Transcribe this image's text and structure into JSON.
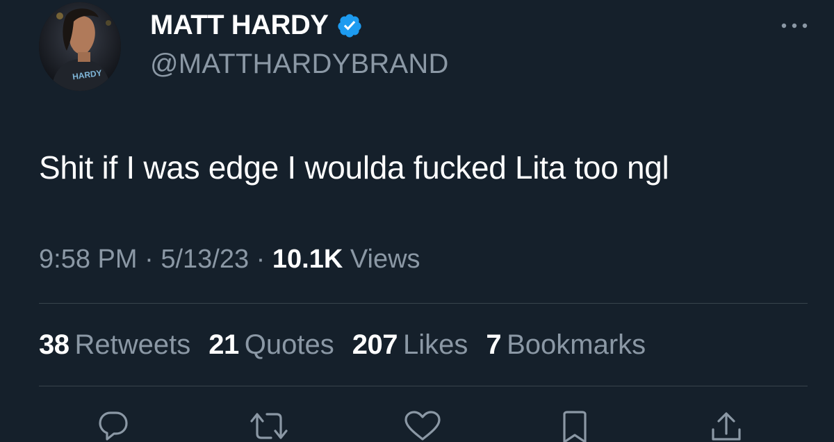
{
  "author": {
    "display_name": "MATT HARDY",
    "handle": "@MATTHARDYBRAND",
    "avatar_shirt_text": "HARDY",
    "verified_icon": "verified-badge-icon"
  },
  "tweet": {
    "text": "Shit if I was edge I woulda fucked Lita too ngl"
  },
  "meta": {
    "time": "9:58 PM",
    "separator1": " · ",
    "date": "5/13/23",
    "separator2": " · ",
    "views_count": "10.1K",
    "views_label": " Views"
  },
  "stats": {
    "retweets_count": "38",
    "retweets_label": "Retweets",
    "quotes_count": "21",
    "quotes_label": "Quotes",
    "likes_count": "207",
    "likes_label": "Likes",
    "bookmarks_count": "7",
    "bookmarks_label": "Bookmarks"
  },
  "actions": {
    "reply": "reply-icon",
    "retweet": "retweet-icon",
    "like": "heart-icon",
    "bookmark": "bookmark-icon",
    "share": "share-icon"
  },
  "colors": {
    "background": "#15202b",
    "text_primary": "#ffffff",
    "text_secondary": "#8b98a5",
    "divider": "#38444d",
    "verified": "#1d9bf0"
  }
}
